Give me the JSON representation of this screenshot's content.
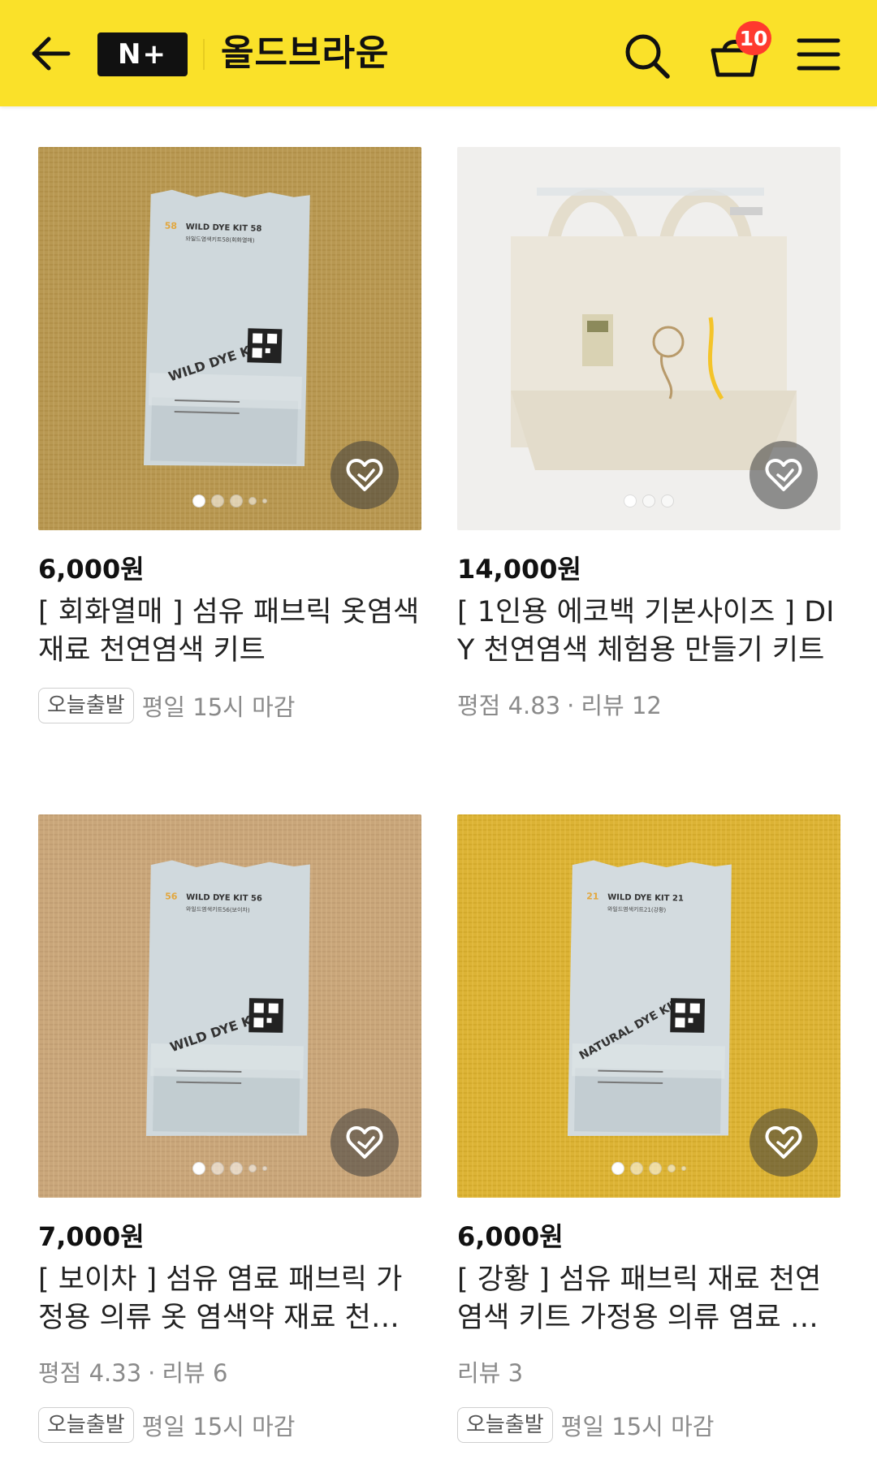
{
  "header": {
    "logo_text": "N+",
    "store_name": "올드브라운",
    "cart_count": "10",
    "icons": [
      "back-arrow-icon",
      "search-icon",
      "basket-icon",
      "hamburger-menu-icon"
    ],
    "bg_color": "#fae129"
  },
  "products": [
    {
      "price": "6,000원",
      "title": "[ 회화열매 ] 섬유 패브릭 옷염색 재료 천연염색 키트",
      "badge": "오늘출발",
      "shipping_note": "평일 15시 마감",
      "image": {
        "bg_color": "#b89852",
        "pkg_number": "58",
        "pkg_title": "WILD DYE KIT 58",
        "pkg_subtitle": "와일드염색키트58(회화열매)",
        "pkg_label": "WILD DYE KIT",
        "dot_count": 5
      }
    },
    {
      "price": "14,000원",
      "title": "[ 1인용 에코백 기본사이즈 ] DIY 천연염색 체험용 만들기 키트",
      "rating": "평점 4.83",
      "reviews": "리뷰 12",
      "image": {
        "bg_color": "#f0efed",
        "dot_count": 3
      }
    },
    {
      "price": "7,000원",
      "title": "[ 보이차 ] 섬유 염료 패브릭 가정용 의류 옷 염색약 재료 천연염색 키트",
      "rating": "평점 4.33",
      "reviews": "리뷰 6",
      "badge": "오늘출발",
      "shipping_note": "평일 15시 마감",
      "image": {
        "bg_color": "#c9a67a",
        "pkg_number": "56",
        "pkg_title": "WILD DYE KIT 56",
        "pkg_subtitle": "와일드염색키트56(보이차)",
        "pkg_label": "WILD DYE KIT",
        "dot_count": 5
      }
    },
    {
      "price": "6,000원",
      "title": "[ 강황 ] 섬유 패브릭 재료 천연염색 키트 가정용 의류 염료 옷 염색약",
      "reviews": "리뷰 3",
      "badge": "오늘출발",
      "shipping_note": "평일 15시 마감",
      "image": {
        "bg_color": "#dcb335",
        "pkg_number": "21",
        "pkg_title": "WILD DYE KIT 21",
        "pkg_subtitle": "와일드염색키트21(강황)",
        "pkg_label": "NATURAL DYE KIT",
        "dot_count": 5
      }
    }
  ]
}
